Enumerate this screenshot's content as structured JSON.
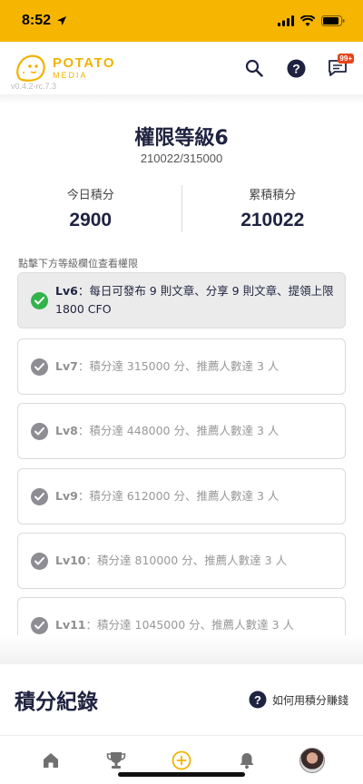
{
  "status_bar": {
    "time": "8:52"
  },
  "header": {
    "logo_name": "POTATO",
    "logo_sub": "MEDIA",
    "version": "v0.4.2-rc.7.3",
    "notification_badge": "99+"
  },
  "level": {
    "title": "權限等級6",
    "progress": "210022/315000"
  },
  "stats": {
    "today_label": "今日積分",
    "today_value": "2900",
    "total_label": "累積積分",
    "total_value": "210022"
  },
  "hint": "點擊下方等級欄位查看權限",
  "levels": [
    {
      "lv": "Lv6",
      "desc": "：每日可發布 9 則文章、分享 9 則文章、提領上限 1800 CFO",
      "current": true
    },
    {
      "lv": "Lv7",
      "desc": "：積分達 315000 分、推薦人數達 3 人",
      "current": false
    },
    {
      "lv": "Lv8",
      "desc": "：積分達 448000 分、推薦人數達 3 人",
      "current": false
    },
    {
      "lv": "Lv9",
      "desc": "：積分達 612000 分、推薦人數達 3 人",
      "current": false
    },
    {
      "lv": "Lv10",
      "desc": "：積分達 810000 分、推薦人數達 3 人",
      "current": false
    },
    {
      "lv": "Lv11",
      "desc": "：積分達 1045000 分、推薦人數達 3 人",
      "current": false
    }
  ],
  "records": {
    "title": "積分紀錄",
    "howto": "如何用積分賺錢"
  },
  "colors": {
    "brand": "#f6b500",
    "navy": "#1f2340",
    "active_check": "#33b34a",
    "inactive_check": "#8d8d93"
  }
}
